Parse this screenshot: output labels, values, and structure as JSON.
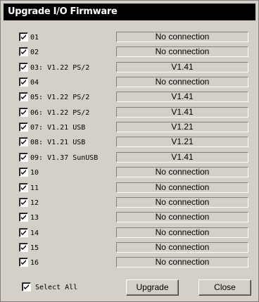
{
  "window": {
    "title": "Upgrade I/O Firmware"
  },
  "ports": [
    {
      "label": "01",
      "checked": true,
      "status": "No connection"
    },
    {
      "label": "02",
      "checked": true,
      "status": "No connection"
    },
    {
      "label": "03: V1.22 PS/2",
      "checked": true,
      "status": "V1.41"
    },
    {
      "label": "04",
      "checked": true,
      "status": "No connection"
    },
    {
      "label": "05: V1.22 PS/2",
      "checked": true,
      "status": "V1.41"
    },
    {
      "label": "06: V1.22 PS/2",
      "checked": true,
      "status": "V1.41"
    },
    {
      "label": "07: V1.21 USB",
      "checked": true,
      "status": "V1.21"
    },
    {
      "label": "08: V1.21 USB",
      "checked": true,
      "status": "V1.21"
    },
    {
      "label": "09: V1.37 SunUSB",
      "checked": true,
      "status": "V1.41"
    },
    {
      "label": "10",
      "checked": true,
      "status": "No connection"
    },
    {
      "label": "11",
      "checked": true,
      "status": "No connection"
    },
    {
      "label": "12",
      "checked": true,
      "status": "No connection"
    },
    {
      "label": "13",
      "checked": true,
      "status": "No connection"
    },
    {
      "label": "14",
      "checked": true,
      "status": "No connection"
    },
    {
      "label": "15",
      "checked": true,
      "status": "No connection"
    },
    {
      "label": "16",
      "checked": true,
      "status": "No connection"
    }
  ],
  "footer": {
    "select_all_label": "Select All",
    "select_all_checked": true,
    "upgrade_label": "Upgrade",
    "close_label": "Close"
  }
}
